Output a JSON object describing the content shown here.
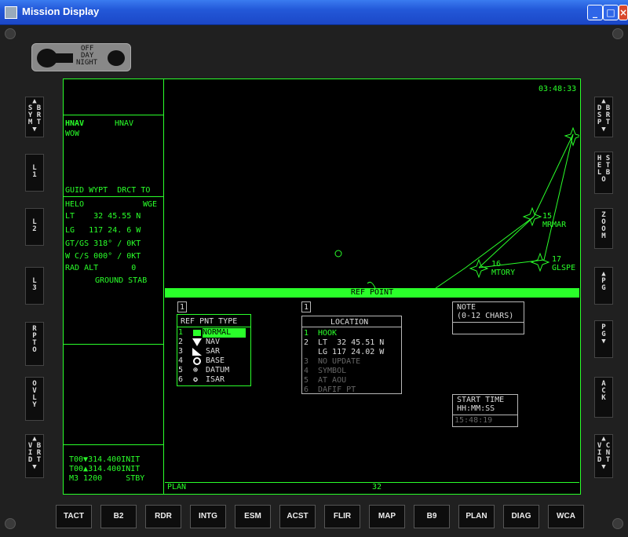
{
  "window": {
    "title": "Mission Display"
  },
  "switch": {
    "labels": [
      "OFF",
      "DAY",
      "NIGHT"
    ]
  },
  "left_buttons": [
    {
      "label": "S\nY\nM\nT",
      "top_arrow": "▲",
      "bottom_arrow": "▼",
      "extra": "B\nR"
    },
    {
      "label": "L\n1"
    },
    {
      "label": "L\n2"
    },
    {
      "label": "L\n3"
    },
    {
      "label": "R\nP\nT\nO"
    },
    {
      "label": "O\nV\nL\nY"
    },
    {
      "label": "V\nB\nI\nR\nD\nT"
    }
  ],
  "right_buttons": [
    {
      "label": "D\nB\nS\nR\nP\nT"
    },
    {
      "label": "H\nS\nE\nT\nL\nB\nO"
    },
    {
      "label": "Z\nO\nO\nM"
    },
    {
      "label": "P\nG"
    },
    {
      "label": "P\nG"
    },
    {
      "label": "A\nC\nK"
    },
    {
      "label": "V\nC\nI\nN\nD\nT"
    }
  ],
  "left_panel": {
    "hnav_1": "HNAV",
    "hnav_2": "HNAV",
    "wow": "WOW",
    "guid_header": "GUID WYPT  DRCT TO",
    "helo": "HELO",
    "wge": "WGE",
    "lt": "LT    32 45.55 N",
    "lg": "LG   117 24. 6 W",
    "gt_gs": "GT/GS 318° / 0KT",
    "wcs": "W C/S 000° / 0KT",
    "rad_alt": "RAD ALT       0",
    "ground_stab": "GROUND STAB",
    "comm_1": "T00▼314.400INIT",
    "comm_2": "T00▲314.400INIT",
    "comm_3": "M3 1200     STBY"
  },
  "map": {
    "time": "03:48:33",
    "waypoints": [
      {
        "num": "15",
        "name": "MRMAR"
      },
      {
        "num": "16",
        "name": "MTORY"
      },
      {
        "num": "17",
        "name": "GLSPE"
      }
    ]
  },
  "ref_point": {
    "bar_title": "REF POINT",
    "panel1_num": "1",
    "type_title": "REF PNT TYPE",
    "types": [
      {
        "num": "1",
        "label": "NORMAL",
        "selected": true
      },
      {
        "num": "2",
        "label": "NAV",
        "selected": false
      },
      {
        "num": "3",
        "label": "SAR",
        "selected": false
      },
      {
        "num": "4",
        "label": "BASE",
        "selected": false
      },
      {
        "num": "5",
        "label": "DATUM",
        "selected": false
      },
      {
        "num": "6",
        "label": "ISAR",
        "selected": false
      }
    ],
    "panel2_num": "1",
    "loc_title": "LOCATION",
    "locs": [
      {
        "num": "1",
        "label": "HOOK",
        "active": true
      },
      {
        "num": "2",
        "label": "LT  32 45.51 N",
        "active": true
      },
      {
        "num": "",
        "label": "LG 117 24.02 W",
        "active": true
      },
      {
        "num": "3",
        "label": "NO UPDATE",
        "active": false
      },
      {
        "num": "4",
        "label": "SYMBOL",
        "active": false
      },
      {
        "num": "5",
        "label": "AT AOU",
        "active": false
      },
      {
        "num": "6",
        "label": "DAFIF PT",
        "active": false
      }
    ],
    "note_title": "NOTE",
    "note_sub": "(0-12 CHARS)",
    "start_title": "START TIME",
    "start_fmt": "HH:MM:SS",
    "start_val": "15:48:19"
  },
  "status": {
    "left": "PLAN",
    "center": "32"
  },
  "func_buttons": [
    "TACT",
    "B2",
    "RDR",
    "INTG",
    "ESM",
    "ACST",
    "FLIR",
    "MAP",
    "B9",
    "PLAN",
    "DIAG",
    "WCA"
  ]
}
